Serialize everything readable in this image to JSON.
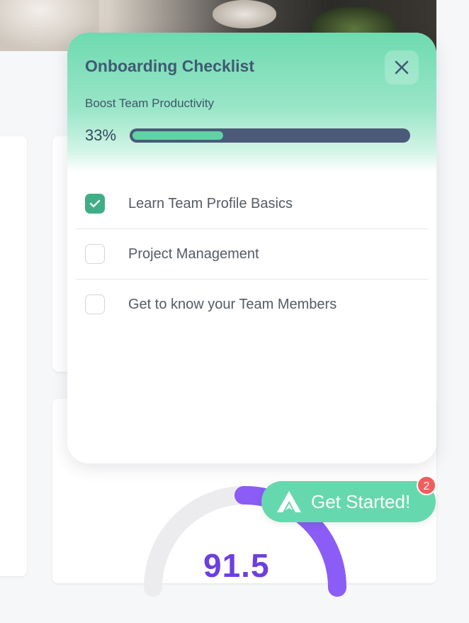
{
  "onboarding": {
    "title": "Onboarding Checklist",
    "subtitle": "Boost Team Productivity",
    "progress_label": "33%",
    "progress_fraction": 0.33,
    "items": [
      {
        "label": "Learn Team Profile Basics",
        "checked": true
      },
      {
        "label": "Project Management",
        "checked": false
      },
      {
        "label": "Get to know your Team Members",
        "checked": false
      }
    ]
  },
  "launcher": {
    "label": "Get Started!",
    "badge_count": "2"
  },
  "background": {
    "gauge_value": "91.5"
  },
  "colors": {
    "accent": "#66d8ad",
    "title": "#3f5a73",
    "progress_track": "#4b5a78",
    "progress_fill": "#5fd3a5",
    "checkbox_checked": "#3fae87",
    "badge": "#f25c5c",
    "gauge": "#8b5cf6"
  },
  "icons": {
    "close": "close-icon",
    "check": "checkmark-icon",
    "launcher": "logo-icon"
  }
}
